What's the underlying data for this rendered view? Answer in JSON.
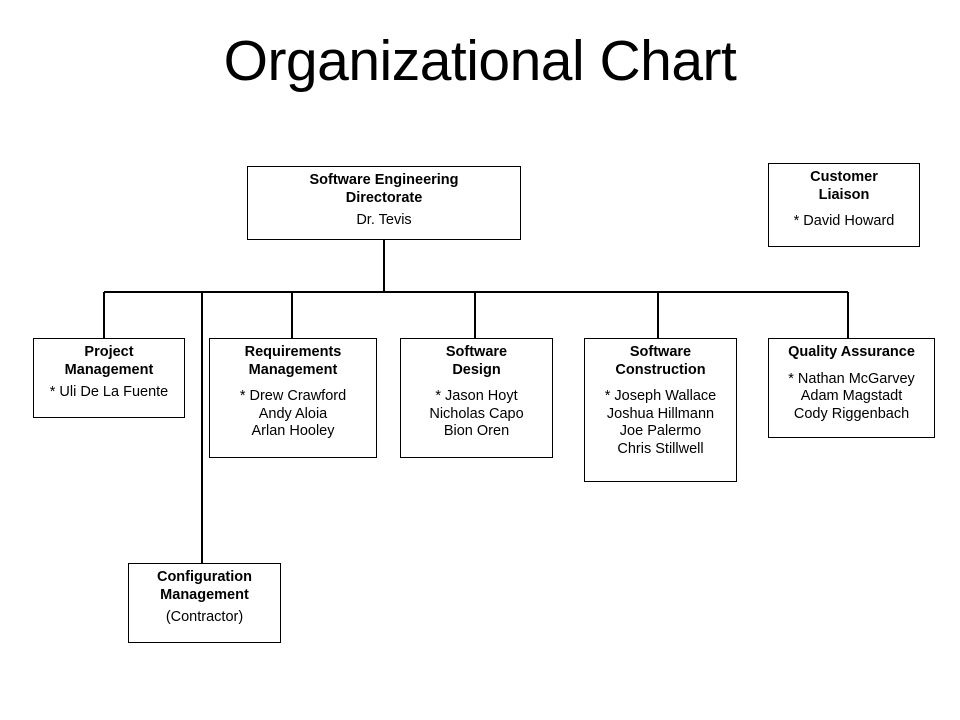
{
  "title": "Organizational Chart",
  "nodes": {
    "root": {
      "title": "Software Engineering\nDirectorate",
      "members": "Dr. Tevis"
    },
    "customer_liaison": {
      "title": "Customer\nLiaison",
      "members": "* David Howard"
    },
    "project_management": {
      "title": "Project\nManagement",
      "members": "* Uli De La Fuente"
    },
    "requirements_management": {
      "title": "Requirements\nManagement",
      "members": "* Drew Crawford\nAndy Aloia\nArlan Hooley"
    },
    "software_design": {
      "title": "Software\nDesign",
      "members": "* Jason Hoyt\nNicholas Capo\nBion Oren"
    },
    "software_construction": {
      "title": "Software\nConstruction",
      "members": "* Joseph Wallace\nJoshua Hillmann\nJoe Palermo\nChris Stillwell"
    },
    "quality_assurance": {
      "title": "Quality Assurance",
      "members": "* Nathan McGarvey\nAdam Magstadt\nCody Riggenbach"
    },
    "configuration_management": {
      "title": "Configuration\nManagement",
      "members": "(Contractor)"
    }
  },
  "colors": {
    "background": "#ffffff",
    "text": "#000000",
    "border": "#000000",
    "connector": "#000000"
  }
}
